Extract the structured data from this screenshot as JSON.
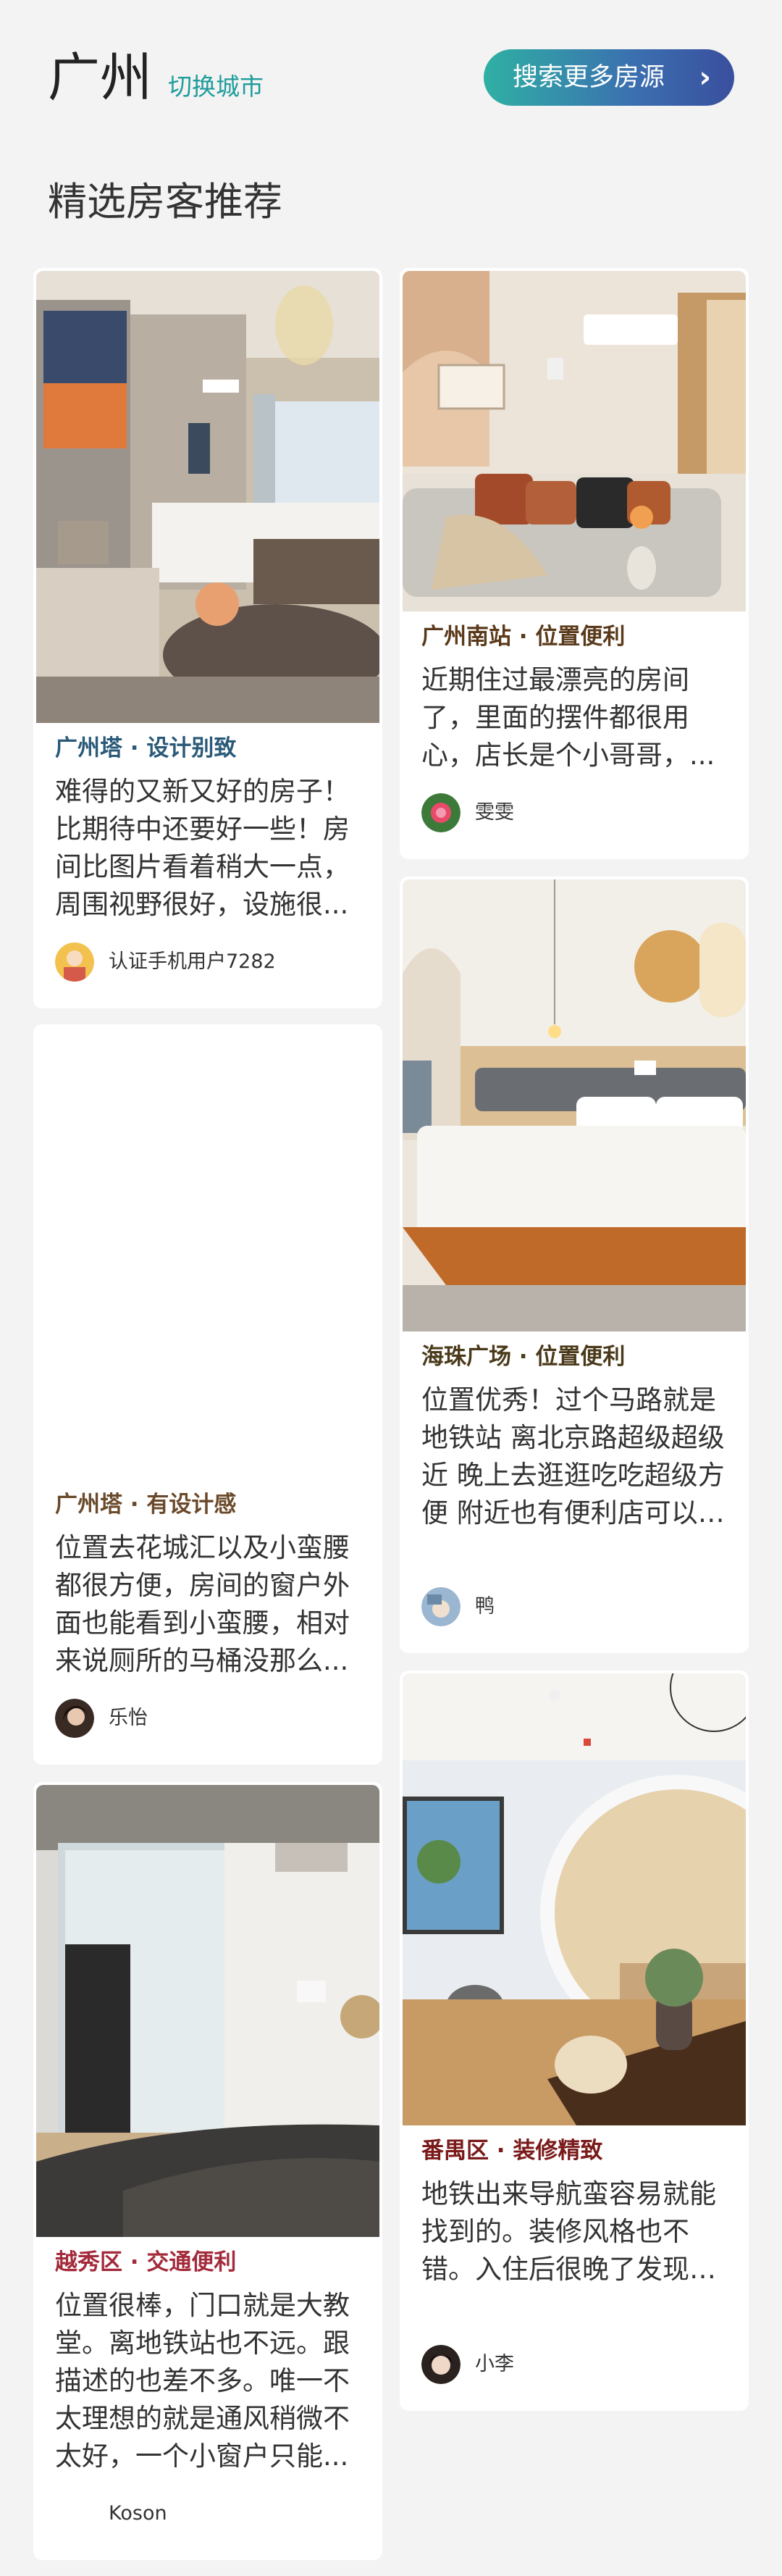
{
  "header": {
    "city": "广州",
    "switch_label": "切换城市",
    "search_button": "搜索更多房源",
    "chevron": "›"
  },
  "section": {
    "title": "精选房客推荐"
  },
  "cards": [
    {
      "tag": "广州塔 · 设计别致",
      "tag_color": "#2a5a78",
      "review": "难得的又新又好的房子！比期待中还要好一些！房间比图片看着稍大一点，周围视野很好，设施很...",
      "user": "认证手机用户7282"
    },
    {
      "tag": "广州南站 · 位置便利",
      "tag_color": "#5a3a1a",
      "review": "近期住过最漂亮的房间了，里面的摆件都很用心，店长是个小哥哥，...",
      "user": "雯雯"
    },
    {
      "tag": "广州塔 · 有设计感",
      "tag_color": "#6a4a2a",
      "review": "位置去花城汇以及小蛮腰都很方便，房间的窗户外面也能看到小蛮腰，相对来说厕所的马桶没那么...",
      "user": "乐怡"
    },
    {
      "tag": "海珠广场 · 位置便利",
      "tag_color": "#4a3a1a",
      "review": "位置优秀！过个马路就是地铁站 离北京路超级超级近 晚上去逛逛吃吃超级方便 附近也有便利店可以寄存行李 房间物品...",
      "user": "鸭"
    },
    {
      "tag": "番禺区 · 装修精致",
      "tag_color": "#7a1a1a",
      "review": "地铁出来导航蛮容易就能找到的。装修风格也不错。入住后很晚了发现清洁阿姨有遗漏上一个房...",
      "user": "小李"
    },
    {
      "tag": "越秀区 · 交通便利",
      "tag_color": "#a32a3a",
      "review": "位置很棒，门口就是大教堂。离地铁站也不远。跟描述的也差不多。唯一不太理想的就是通风稍微不太好，一个小窗户只能...",
      "user": "Koson"
    }
  ]
}
